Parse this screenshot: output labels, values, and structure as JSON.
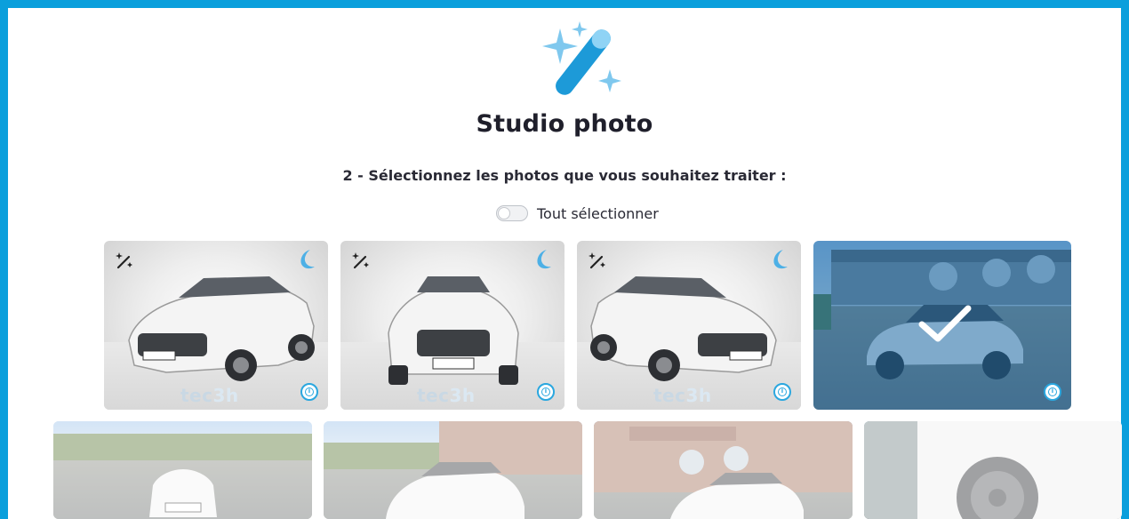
{
  "page": {
    "title": "Studio photo",
    "subtitle": "2 - Sélectionnez les photos que vous souhaitez traiter :",
    "select_all_label": "Tout sélectionner",
    "select_all_checked": false
  },
  "theme": {
    "accent": "#0a9fdc",
    "selected_overlay": "#1f6eaa"
  },
  "icons": {
    "header": "magic-wand-icon",
    "badge": "magic-wand-icon",
    "info": "info-icon",
    "check": "check-icon",
    "brand": "tec3h-moon-logo"
  },
  "photos": [
    {
      "kind": "studio",
      "view": "front-three-quarter",
      "plate": "FX-718-YL",
      "watermark": [
        "tec",
        "3h"
      ],
      "selected": false
    },
    {
      "kind": "studio",
      "view": "front",
      "plate": "FX-718-YL",
      "watermark": [
        "tec",
        "3h"
      ],
      "selected": false
    },
    {
      "kind": "studio",
      "view": "front-three-quarter-right",
      "plate": "FX-718-YL",
      "watermark": [
        "tec",
        "3h"
      ],
      "selected": false
    },
    {
      "kind": "raw",
      "view": "side-parking",
      "selected": true
    },
    {
      "kind": "raw",
      "view": "rear-parking",
      "selected": false
    },
    {
      "kind": "raw",
      "view": "rear-three-quarter-parking",
      "selected": false
    },
    {
      "kind": "raw",
      "view": "side-building",
      "selected": false
    },
    {
      "kind": "raw",
      "view": "wheel-closeup",
      "selected": false
    }
  ]
}
